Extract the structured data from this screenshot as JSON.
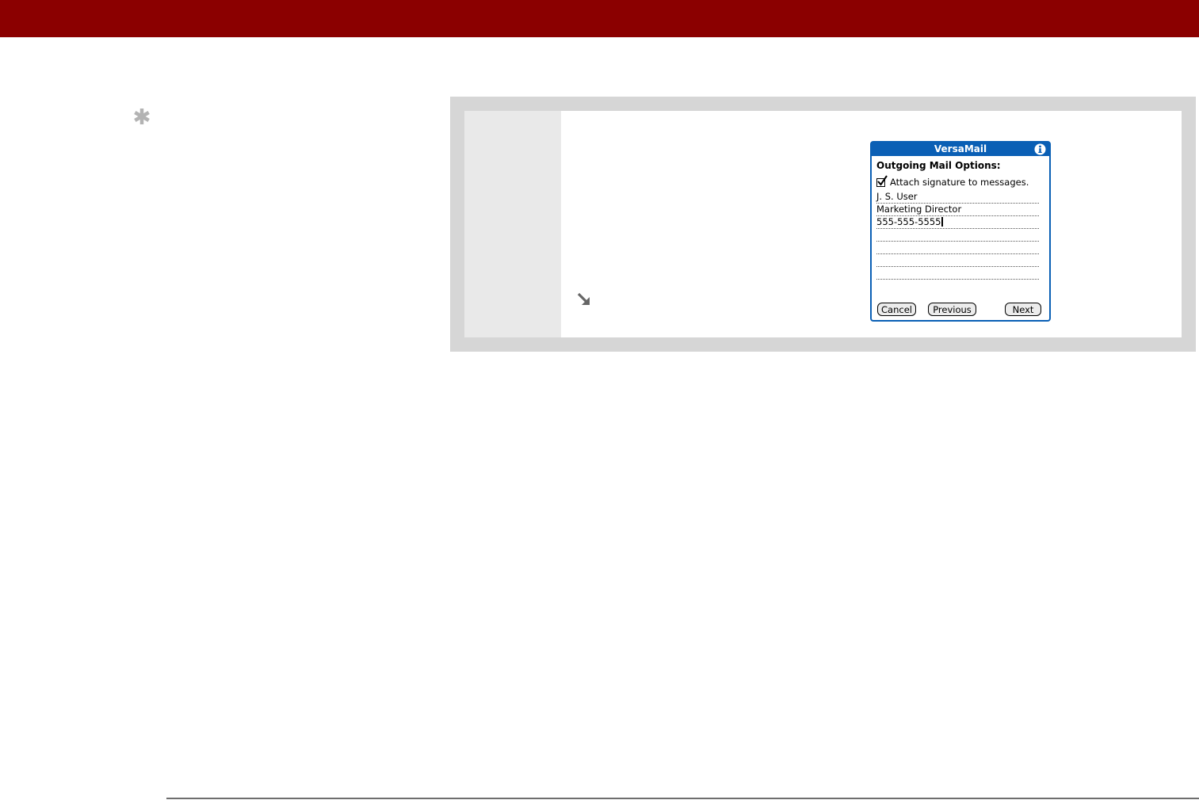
{
  "colors": {
    "header_bar": "#8b0000",
    "panel_gray": "#d6d6d6",
    "panel_light": "#e9e9e9",
    "palm_blue": "#0a5fb5",
    "icon_gray": "#b3b3b3"
  },
  "icons": {
    "tip": "asterisk-icon",
    "step": "arrow-down-right-icon",
    "info": "info-icon",
    "check": "checkmark-icon"
  },
  "device": {
    "app_title": "VersaMail",
    "section_label": "Outgoing Mail Options:",
    "attach_signature_label": "Attach signature to messages.",
    "attach_signature_checked": true,
    "signature_lines": [
      "J. S. User",
      "Marketing Director",
      "555-555-5555",
      "",
      "",
      "",
      ""
    ],
    "buttons": {
      "cancel": "Cancel",
      "previous": "Previous",
      "next": "Next"
    }
  }
}
